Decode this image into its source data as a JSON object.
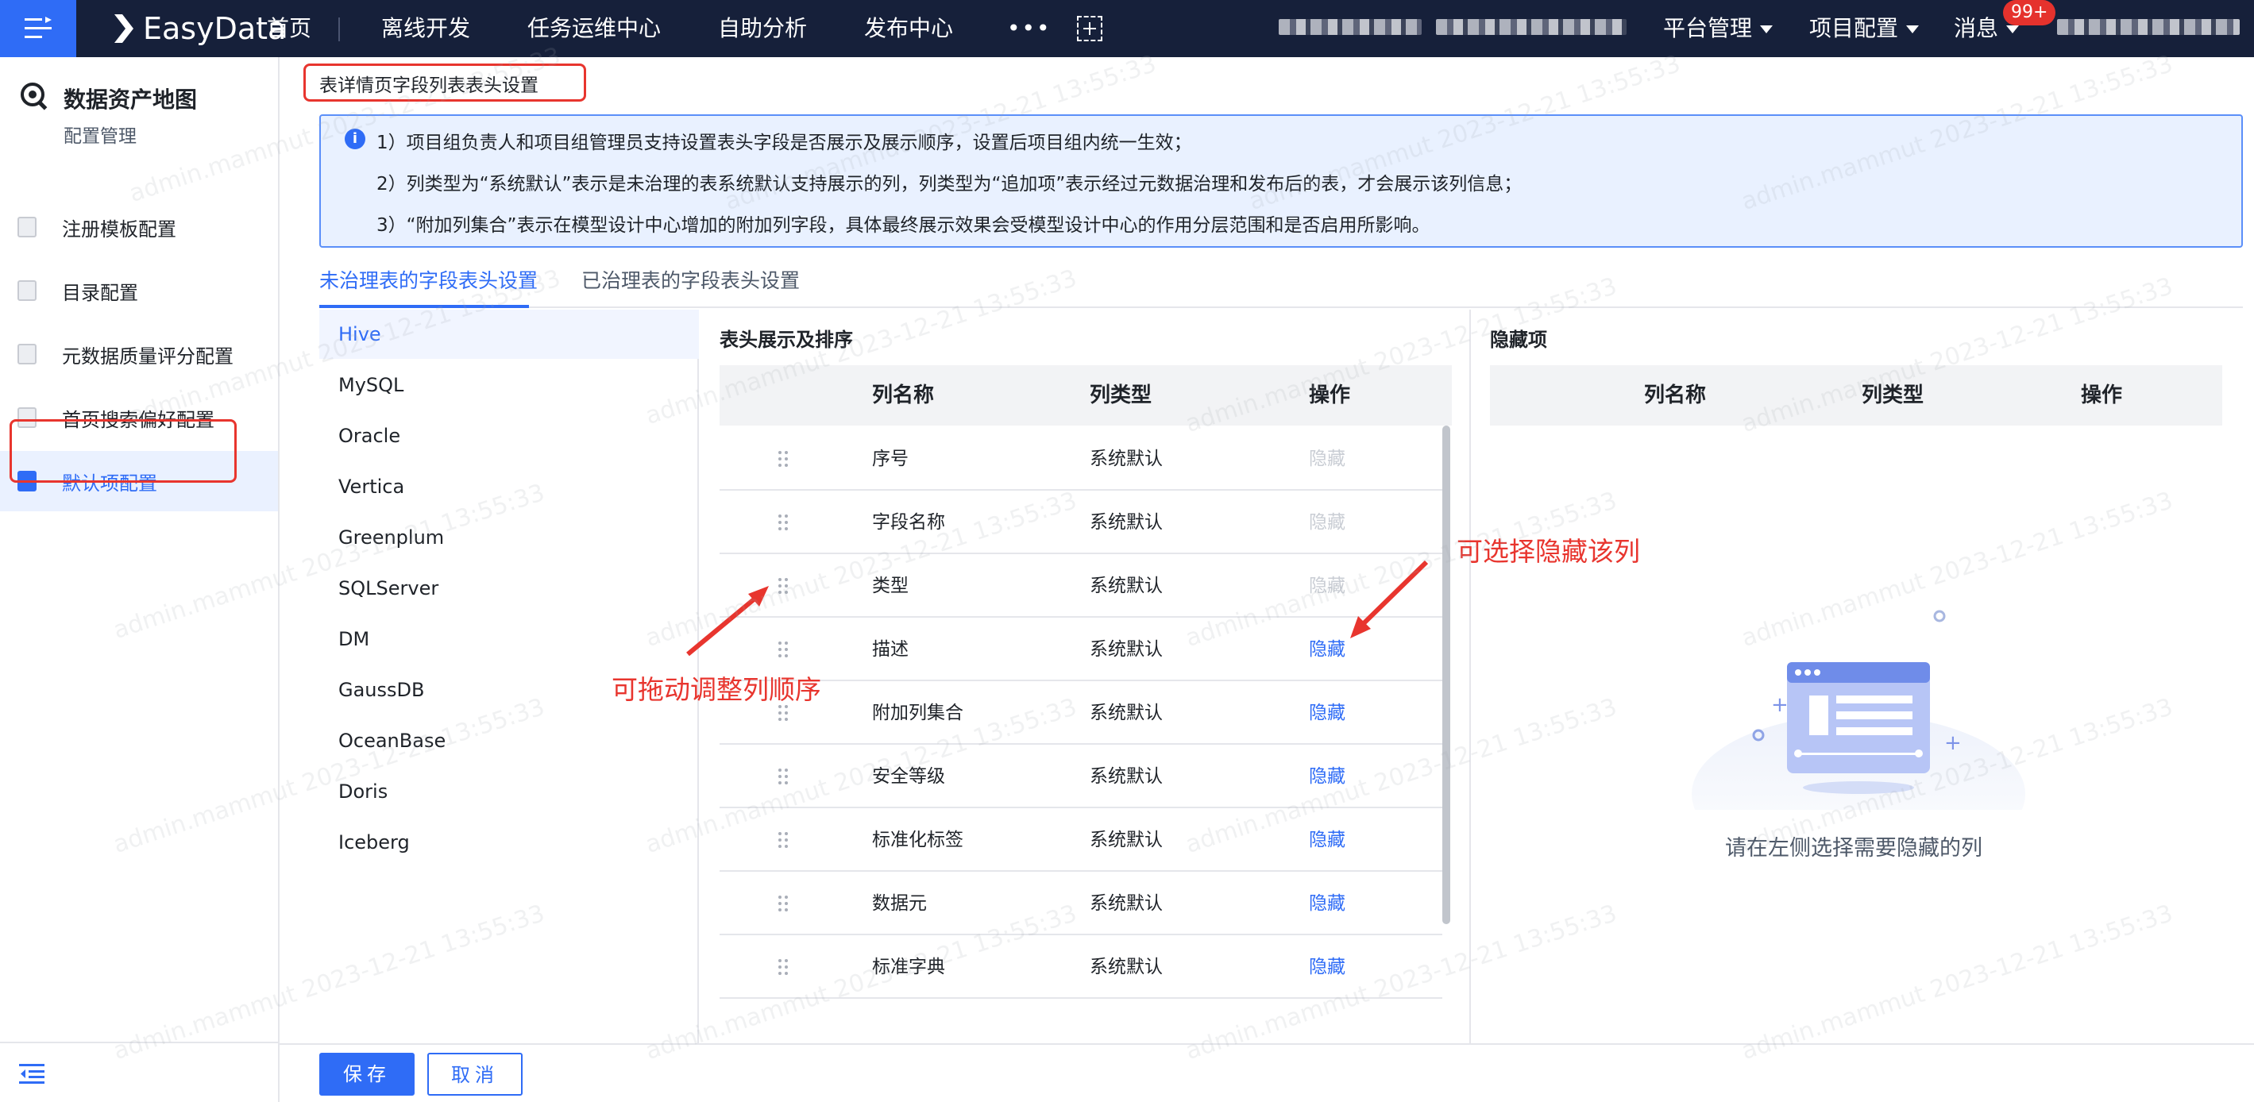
{
  "topbar": {
    "brand": "EasyData",
    "nav": [
      "首页",
      "离线开发",
      "任务运维中心",
      "自助分析",
      "发布中心"
    ],
    "more": "•••",
    "right_menus": [
      "平台管理",
      "项目配置",
      "消息"
    ],
    "message_badge": "99+"
  },
  "sidebar": {
    "title": "数据资产地图",
    "subtitle": "配置管理",
    "items": [
      {
        "label": "注册模板配置"
      },
      {
        "label": "目录配置"
      },
      {
        "label": "元数据质量评分配置"
      },
      {
        "label": "首页搜索偏好配置"
      },
      {
        "label": "默认项配置",
        "active": true
      }
    ]
  },
  "page": {
    "title": "表详情页字段列表表头设置",
    "info_lines": [
      "1）项目组负责人和项目组管理员支持设置表头字段是否展示及展示顺序，设置后项目组内统一生效；",
      "2）列类型为“系统默认”表示是未治理的表系统默认支持展示的列，列类型为“追加项”表示经过元数据治理和发布后的表，才会展示该列信息；",
      "3）“附加列集合”表示在模型设计中心增加的附加列字段，具体最终展示效果会受模型设计中心的作用分层范围和是否启用所影响。"
    ],
    "tabs": [
      "未治理表的字段表头设置",
      "已治理表的字段表头设置"
    ],
    "databases": [
      "Hive",
      "MySQL",
      "Oracle",
      "Vertica",
      "Greenplum",
      "SQLServer",
      "DM",
      "GaussDB",
      "OceanBase",
      "Doris",
      "Iceberg"
    ],
    "sort_section": {
      "label": "表头展示及排序",
      "columns": [
        "列名称",
        "列类型",
        "操作"
      ],
      "rows": [
        {
          "name": "序号",
          "type": "系统默认",
          "op": "隐藏",
          "disabled": true
        },
        {
          "name": "字段名称",
          "type": "系统默认",
          "op": "隐藏",
          "disabled": true
        },
        {
          "name": "类型",
          "type": "系统默认",
          "op": "隐藏",
          "disabled": true
        },
        {
          "name": "描述",
          "type": "系统默认",
          "op": "隐藏",
          "disabled": false
        },
        {
          "name": "附加列集合",
          "type": "系统默认",
          "op": "隐藏",
          "disabled": false
        },
        {
          "name": "安全等级",
          "type": "系统默认",
          "op": "隐藏",
          "disabled": false
        },
        {
          "name": "标准化标签",
          "type": "系统默认",
          "op": "隐藏",
          "disabled": false
        },
        {
          "name": "数据元",
          "type": "系统默认",
          "op": "隐藏",
          "disabled": false
        },
        {
          "name": "标准字典",
          "type": "系统默认",
          "op": "隐藏",
          "disabled": false
        }
      ]
    },
    "hidden_section": {
      "label": "隐藏项",
      "columns": [
        "列名称",
        "列类型",
        "操作"
      ],
      "empty_text": "请在左侧选择需要隐藏的列"
    },
    "annotations": {
      "drag_hint": "可拖动调整列顺序",
      "hide_hint": "可选择隐藏该列"
    },
    "buttons": {
      "save": "保存",
      "cancel": "取消"
    },
    "watermark": "admin.mammut 2023-12-21 13:55:33"
  }
}
